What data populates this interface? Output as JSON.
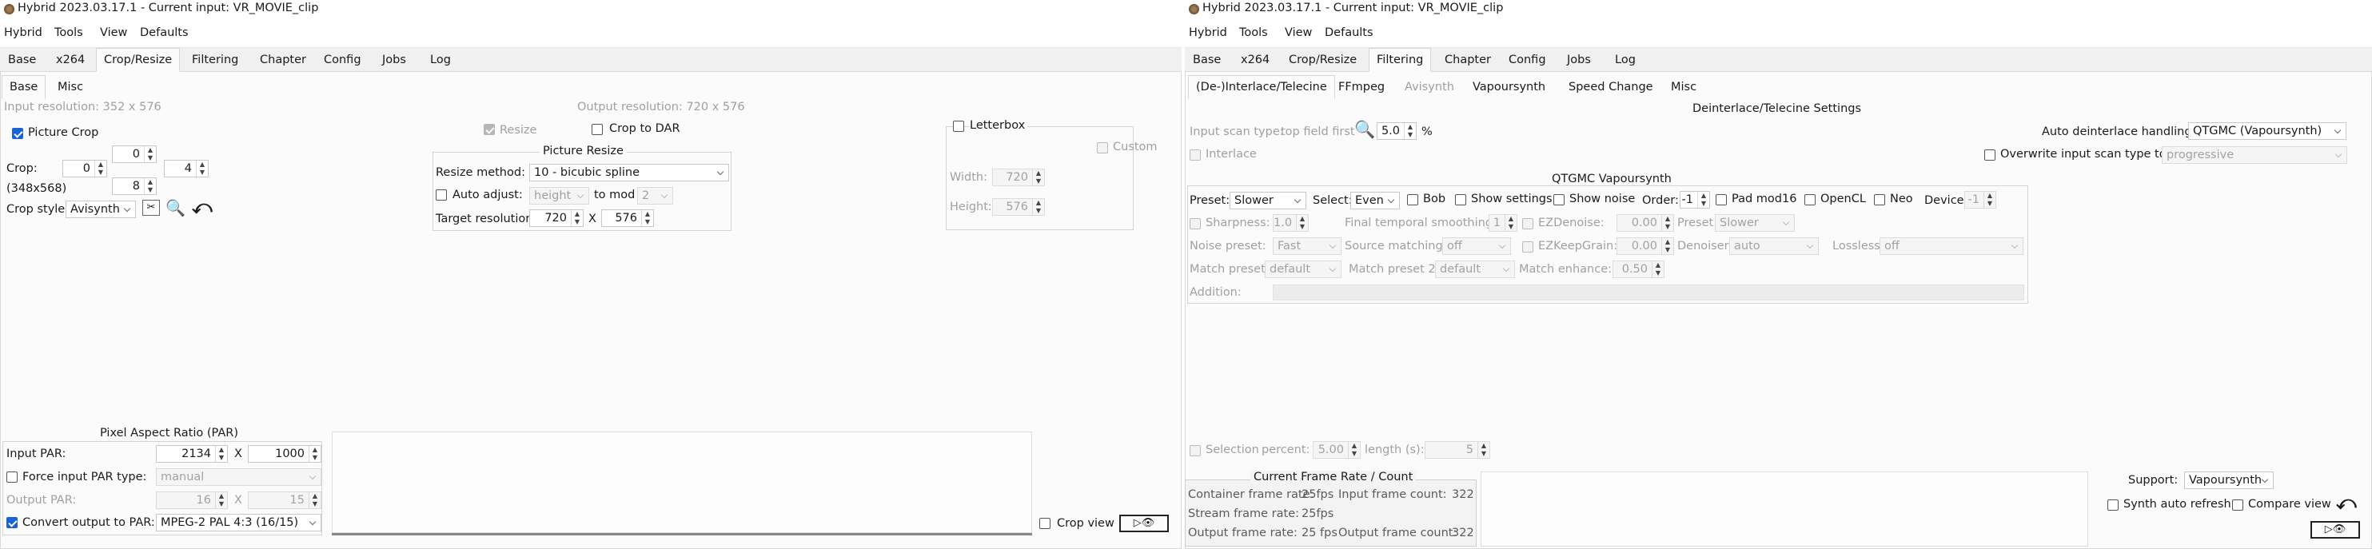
{
  "left": {
    "title": "Hybrid 2023.03.17.1 - Current input: VR_MOVIE_clip",
    "menu": [
      "Hybrid",
      "Tools",
      "View",
      "Defaults"
    ],
    "tabs": [
      "Base",
      "x264",
      "Crop/Resize",
      "Filtering",
      "Chapter",
      "Config",
      "Jobs",
      "Log"
    ],
    "subtabs": [
      "Base",
      "Misc"
    ],
    "input_resolution": "Input resolution: 352 x 576",
    "output_resolution": "Output resolution: 720 x 576",
    "picture_crop": "Picture Crop",
    "crop_label": "Crop:",
    "crop_top": "0",
    "crop_left": "0",
    "crop_right": "4",
    "crop_bottom": "8",
    "crop_dims": "(348x568)",
    "crop_style_label": "Crop style:",
    "crop_style": "Avisynth",
    "resize": "Resize",
    "crop_to_dar": "Crop to DAR",
    "picture_resize_title": "Picture Resize",
    "resize_method_label": "Resize method:",
    "resize_method": "10 - bicubic spline",
    "auto_adjust": "Auto adjust:",
    "auto_adjust_value": "height",
    "to_mod": "to mod",
    "to_mod_value": "2",
    "target_resolution_label": "Target resolution:",
    "target_w": "720",
    "x": "X",
    "target_h": "576",
    "letterbox": "Letterbox",
    "custom": "Custom",
    "width_label": "Width:",
    "width_value": "720",
    "height_label": "Height:",
    "height_value": "576",
    "par_title": "Pixel Aspect Ratio (PAR)",
    "input_par_label": "Input PAR:",
    "input_par_a": "2134",
    "input_par_b": "1000",
    "force_par": "Force input PAR type:",
    "force_par_value": "manual",
    "output_par_label": "Output PAR:",
    "output_par_a": "16",
    "output_par_b": "15",
    "convert_par": "Convert output to PAR:",
    "convert_par_value": "MPEG-2 PAL 4:3 (16/15)",
    "crop_view": "Crop view"
  },
  "right": {
    "title": "Hybrid 2023.03.17.1 - Current input: VR_MOVIE_clip",
    "menu": [
      "Hybrid",
      "Tools",
      "View",
      "Defaults"
    ],
    "tabs": [
      "Base",
      "x264",
      "Crop/Resize",
      "Filtering",
      "Chapter",
      "Config",
      "Jobs",
      "Log"
    ],
    "subtabs": [
      "(De-)Interlace/Telecine",
      "FFmpeg",
      "Avisynth",
      "Vapoursynth",
      "Speed Change",
      "Misc"
    ],
    "deint_title": "Deinterlace/Telecine Settings",
    "scan_type_label": "Input scan type:",
    "scan_type_value": "top field first",
    "zoom_value": "5.0",
    "percent": "%",
    "auto_deint_label": "Auto deinterlace handling:",
    "auto_deint_value": "QTGMC (Vapoursynth)",
    "interlace": "Interlace",
    "overwrite_scan": "Overwrite input scan type to:",
    "overwrite_scan_value": "progressive",
    "qtgmc_title": "QTGMC Vapoursynth",
    "preset_label": "Preset:",
    "preset_value": "Slower",
    "select_label": "Select:",
    "select_value": "Even",
    "bob": "Bob",
    "show_settings": "Show settings",
    "show_noise": "Show noise",
    "order_label": "Order:",
    "order_value": "-1",
    "pad_mod16": "Pad mod16",
    "opencl": "OpenCL",
    "neo": "Neo",
    "device_label": "Device:",
    "device_value": "-1",
    "sharpness": "Sharpness:",
    "sharpness_value": "1.0",
    "final_temporal": "Final temporal smoothing:",
    "final_temporal_value": "1",
    "ezdenoise": "EZDenoise:",
    "ezdenoise_value": "0.00",
    "preset2_label": "Preset:",
    "preset2_value": "Slower",
    "noise_preset_label": "Noise preset:",
    "noise_preset_value": "Fast",
    "source_matching_label": "Source matching:",
    "source_matching_value": "off",
    "ezkeepgrain": "EZKeepGrain:",
    "ezkeepgrain_value": "0.00",
    "denoiser_label": "Denoiser:",
    "denoiser_value": "auto",
    "lossless_label": "Lossless:",
    "lossless_value": "off",
    "match_preset_label": "Match preset:",
    "match_preset_value": "default",
    "match_preset2_label": "Match preset 2:",
    "match_preset2_value": "default",
    "match_enhance_label": "Match enhance:",
    "match_enhance_value": "0.50",
    "addition_label": "Addition:",
    "selection": "Selection",
    "sel_percent_label": "percent:",
    "sel_percent_value": "5.00",
    "sel_length_label": "length (s):",
    "sel_length_value": "5",
    "frame_title": "Current Frame Rate / Count",
    "container_fr": "Container frame rate:",
    "container_fr_value": "25fps",
    "stream_fr": "Stream frame rate:",
    "stream_fr_value": "25fps",
    "output_fr": "Output frame rate:",
    "output_fr_value": "25 fps",
    "input_fc": "Input frame count:",
    "input_fc_value": "322",
    "output_fc": "Output frame count:",
    "output_fc_value": "322",
    "support_label": "Support:",
    "support_value": "Vapoursynth",
    "synth_auto_refresh": "Synth auto refresh",
    "compare_view": "Compare view"
  },
  "colors": {
    "accent": "#1864d6",
    "bg": "#f0f0f0",
    "pane": "#fbfbfb"
  }
}
